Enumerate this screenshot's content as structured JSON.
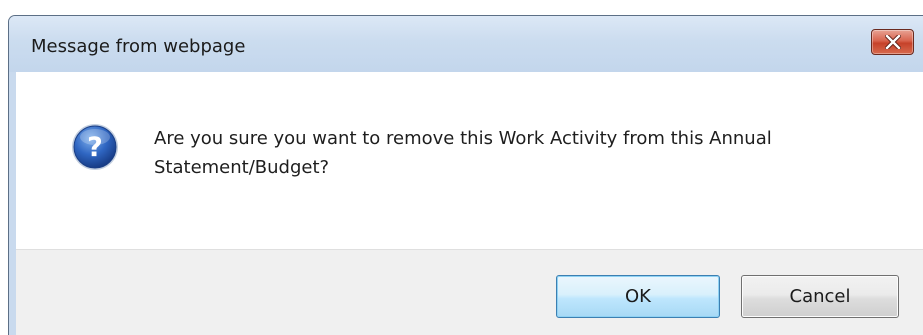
{
  "dialog": {
    "title": "Message from webpage",
    "close_icon": "close-x-icon",
    "message_icon": "question-icon",
    "message": "Are you sure you want to remove this Work Activity from this Annual Statement/Budget?",
    "buttons": {
      "ok_label": "OK",
      "cancel_label": "Cancel"
    }
  },
  "colors": {
    "titlebar": "#c9daee",
    "close_button": "#c6422a",
    "ok_border": "#3c7fb1",
    "icon_blue": "#2a5fb0"
  }
}
